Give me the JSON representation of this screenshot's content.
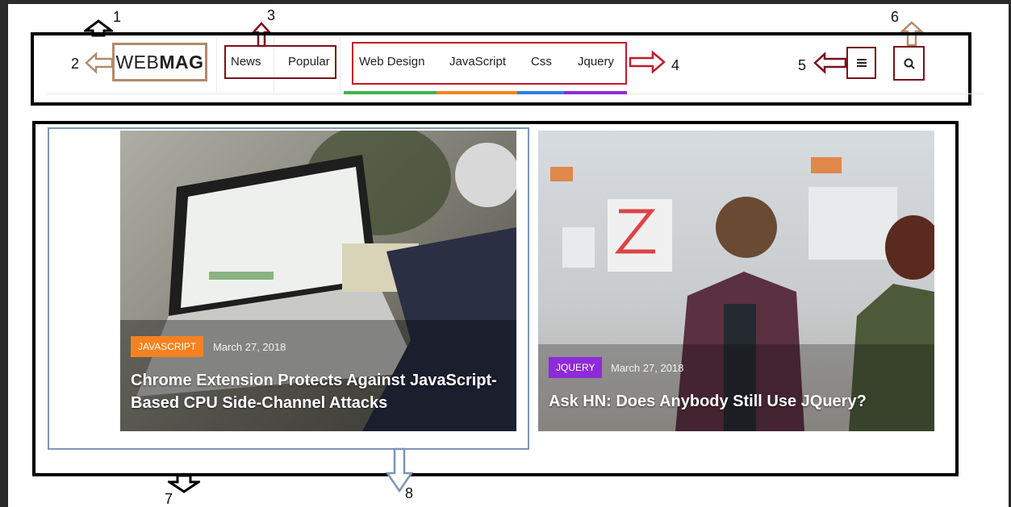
{
  "annotations": [
    "1",
    "2",
    "3",
    "4",
    "5",
    "6",
    "7",
    "8"
  ],
  "header": {
    "logo": {
      "prefix": "WEB",
      "bold": "MAG"
    },
    "primary_nav": [
      {
        "label": "News"
      },
      {
        "label": "Popular"
      }
    ],
    "category_nav": [
      {
        "label": "Web Design",
        "color": "#3cb44b"
      },
      {
        "label": "JavaScript",
        "color": "#f58220"
      },
      {
        "label": "Css",
        "color": "#2f7fe0"
      },
      {
        "label": "Jquery",
        "color": "#8e2bd9"
      }
    ],
    "menu_icon": "hamburger-icon",
    "search_icon": "search-icon"
  },
  "posts": [
    {
      "tag": "JAVASCRIPT",
      "tag_color": "#f58220",
      "date": "March 27, 2018",
      "title_line1": "Chrome Extension Protects Against JavaScript-",
      "title_line2": "Based CPU Side-Channel Attacks"
    },
    {
      "tag": "JQUERY",
      "tag_color": "#8e2bd9",
      "date": "March 27, 2018",
      "title_line1": "Ask HN: Does Anybody Still Use JQuery?"
    }
  ],
  "colors": {
    "annotation_red": "#c21b2b",
    "annotation_maroon": "#7a0f1a",
    "annotation_tan": "#b08a6e",
    "annotation_blue": "#7c95b6"
  }
}
